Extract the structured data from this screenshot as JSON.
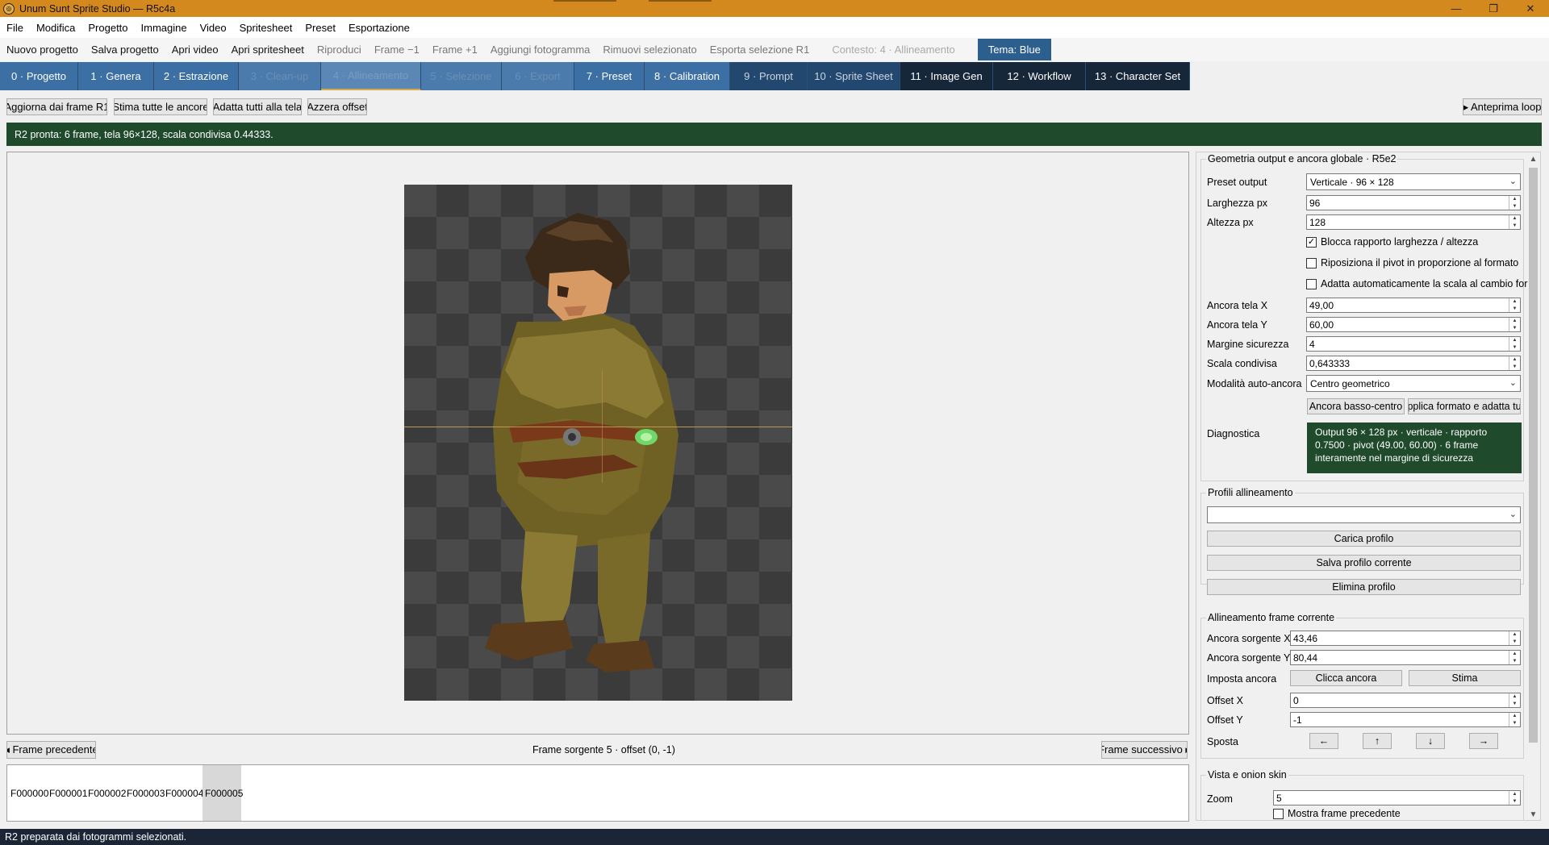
{
  "window": {
    "title": "Unum Sunt Sprite Studio — R5c4a",
    "controls": [
      "—",
      "❐",
      "✕"
    ]
  },
  "menu": [
    "File",
    "Modifica",
    "Progetto",
    "Immagine",
    "Video",
    "Spritesheet",
    "Preset",
    "Esportazione"
  ],
  "toolbar": {
    "actions": [
      {
        "label": "Nuovo progetto",
        "enabled": true
      },
      {
        "label": "Salva progetto",
        "enabled": true
      },
      {
        "label": "Apri video",
        "enabled": true
      },
      {
        "label": "Apri spritesheet",
        "enabled": true
      },
      {
        "label": "Riproduci",
        "enabled": false
      },
      {
        "label": "Frame −1",
        "enabled": false
      },
      {
        "label": "Frame +1",
        "enabled": false
      },
      {
        "label": "Aggiungi fotogramma",
        "enabled": false
      },
      {
        "label": "Rimuovi selezionato",
        "enabled": false
      },
      {
        "label": "Esporta selezione R1",
        "enabled": false
      }
    ],
    "context": "Contesto: 4 · Allineamento",
    "theme": "Tema: Blue"
  },
  "tabs": [
    "0 · Progetto",
    "1 · Genera",
    "2 · Estrazione",
    "3 · Clean-up",
    "4 · Allineamento",
    "5 · Selezione",
    "6 · Export",
    "7 · Preset",
    "8 · Calibration",
    "9 · Prompt",
    "10 · Sprite Sheet",
    "11 · Image Gen",
    "12 · Workflow",
    "13 · Character Set"
  ],
  "actions": {
    "refresh": "Aggiorna dai frame R1",
    "estimate_all": "Stima tutte le ancore",
    "fit_all": "Adatta tutti alla tela",
    "reset_offset": "Azzera offset",
    "preview_loop": "▸ Anteprima loop"
  },
  "status": "R2 pronta: 6 frame, tela 96×128, scala condivisa 0.44333.",
  "navigation": {
    "prev": "◂ Frame precedente",
    "next": "Frame successivo ▸",
    "info": "Frame sorgente 5 · offset (0, -1)"
  },
  "frames": [
    "F000000",
    "F000001",
    "F000002",
    "F000003",
    "F000004",
    "F000005"
  ],
  "selected_frame": 5,
  "bottom_status": "R2 preparata dai fotogrammi selezionati.",
  "geometry": {
    "title": "Geometria output e ancora globale · R5e2",
    "preset_label": "Preset output",
    "preset_value": "Verticale · 96 × 128",
    "width_label": "Larghezza px",
    "width_value": "96",
    "height_label": "Altezza px",
    "height_value": "128",
    "lock_ratio": "Blocca rapporto larghezza / altezza",
    "lock_ratio_checked": true,
    "reposition_pivot": "Riposiziona il pivot in proporzione al formato",
    "reposition_pivot_checked": false,
    "auto_scale": "Adatta automaticamente la scala al cambio for",
    "auto_scale_checked": false,
    "anchor_x_label": "Ancora tela X",
    "anchor_x_value": "49,00",
    "anchor_y_label": "Ancora tela Y",
    "anchor_y_value": "60,00",
    "margin_label": "Margine sicurezza",
    "margin_value": "4",
    "scale_label": "Scala condivisa",
    "scale_value": "0,643333",
    "mode_label": "Modalità auto-ancora",
    "mode_value": "Centro geometrico",
    "anchor_bottom_btn": "Ancora basso-centro",
    "apply_format_btn": "pplica formato e adatta tu",
    "diagnostic_label": "Diagnostica",
    "diagnostic_text": "Output 96 × 128 px · verticale · rapporto 0.7500 · pivot (49.00, 60.00) · 6 frame interamente nel margine di sicurezza"
  },
  "profiles": {
    "title": "Profili allineamento",
    "selected": "",
    "load": "Carica profilo",
    "save": "Salva profilo corrente",
    "delete": "Elimina profilo"
  },
  "current_frame": {
    "title": "Allineamento frame corrente",
    "src_x_label": "Ancora sorgente X",
    "src_x_value": "43,46",
    "src_y_label": "Ancora sorgente Y",
    "src_y_value": "80,44",
    "set_anchor_label": "Imposta ancora",
    "click_anchor": "Clicca ancora",
    "estimate": "Stima",
    "offset_x_label": "Offset X",
    "offset_x_value": "0",
    "offset_y_label": "Offset Y",
    "offset_y_value": "-1",
    "move_label": "Sposta",
    "move_left": "←",
    "move_up": "↑",
    "move_down": "↓",
    "move_right": "→"
  },
  "view": {
    "title": "Vista e onion skin",
    "zoom_label": "Zoom",
    "zoom_value": "5",
    "show_prev": "Mostra frame precedente",
    "show_prev_checked": false
  },
  "colors": {
    "title_bar": "#d4891f",
    "tab_dark": "#17273a",
    "status_green": "#1f4a2c",
    "theme_button": "#2c5e8e"
  }
}
